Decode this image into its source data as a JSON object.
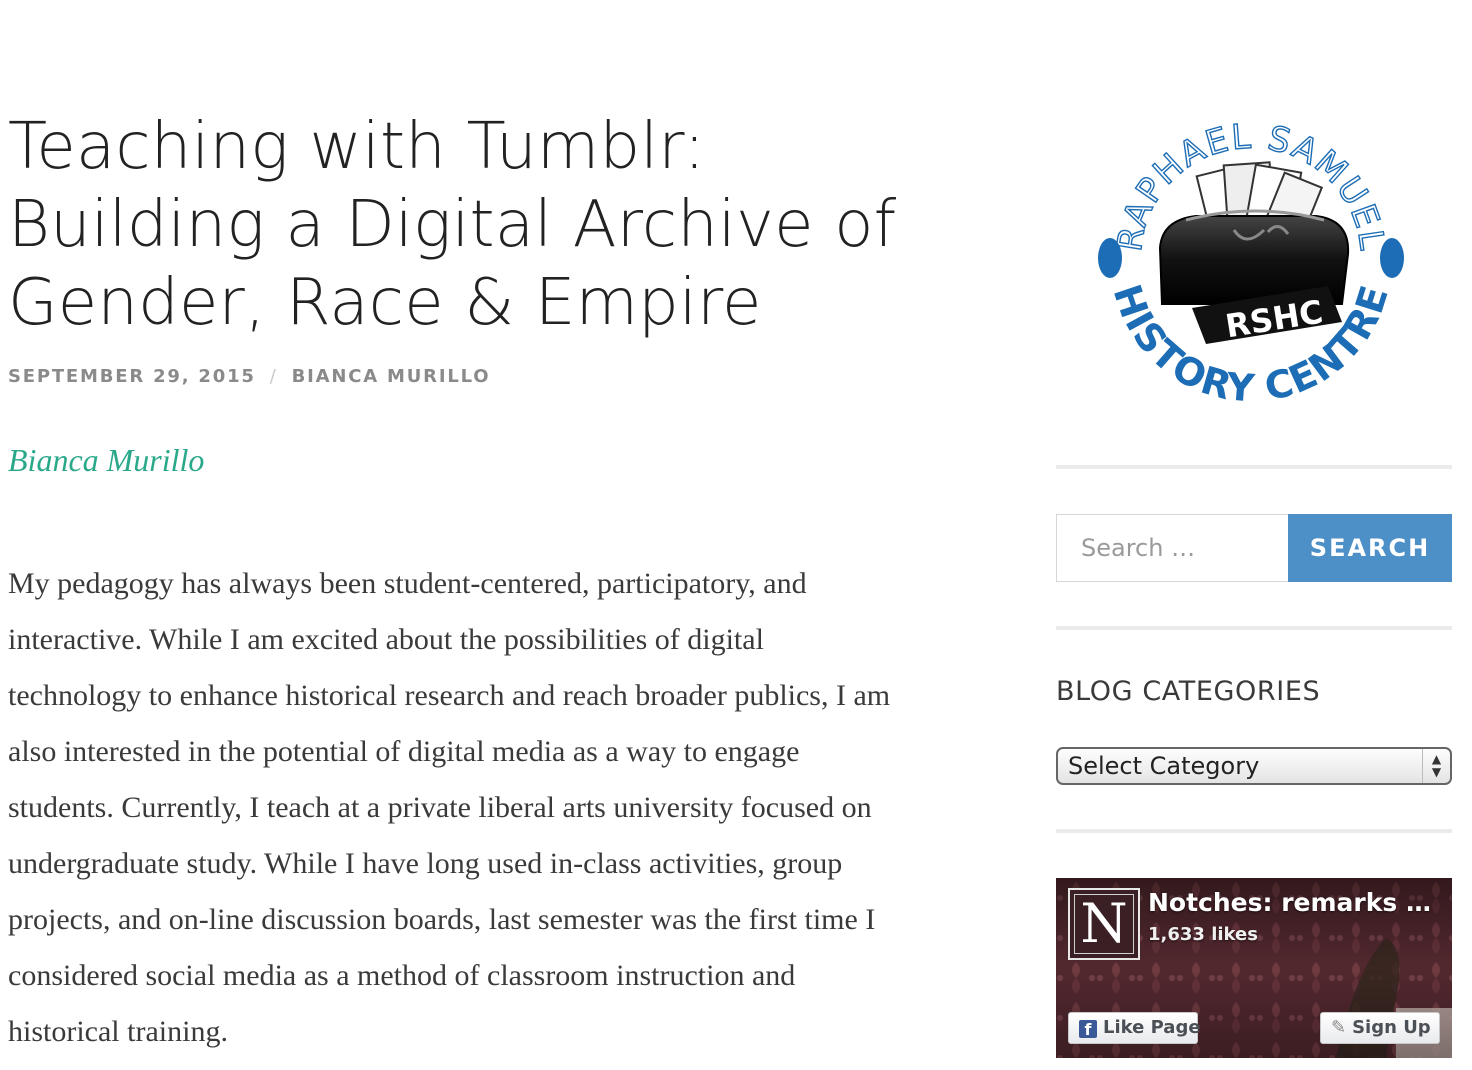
{
  "article": {
    "title_lines": [
      "Teaching with Tumblr:",
      "Building a Digital Archive of",
      "Gender, Race & Empire"
    ],
    "date": "SEPTEMBER 29, 2015",
    "separator": "/",
    "author": "BIANCA MURILLO",
    "byline": "Bianca Murillo",
    "body_lines": [
      "My pedagogy has always been student-centered, participatory, and",
      "interactive. While I am excited about the possibilities of digital",
      "technology to enhance historical research and reach broader publics, I am",
      "also interested in the potential of digital media as a way to engage",
      "students. Currently, I teach at a private liberal arts university focused on",
      "undergraduate study. While I have long used in-class activities, group",
      "projects, and on-line discussion boards, last semester was the first time I",
      "considered social media as a method of classroom instruction and",
      "historical training."
    ]
  },
  "sidebar": {
    "logo": {
      "top_text": "RAPHAEL SAMUEL",
      "badge_text": "RSHC",
      "bottom_text": "HISTORY CENTRE",
      "color": "#1c6db5"
    },
    "search": {
      "placeholder": "Search …",
      "button_label": "SEARCH",
      "button_color": "#4d8fc7"
    },
    "categories": {
      "title": "BLOG CATEGORIES",
      "selected": "Select Category"
    },
    "facebook": {
      "page_initial": "N",
      "page_name": "Notches: remarks …",
      "likes": "1,633 likes",
      "like_label": "Like Page",
      "signup_label": "Sign Up",
      "f_glyph": "f"
    }
  },
  "colors": {
    "accent_green": "#2aa88a",
    "meta_gray": "#8a8a8a",
    "text": "#3a3a3a"
  }
}
